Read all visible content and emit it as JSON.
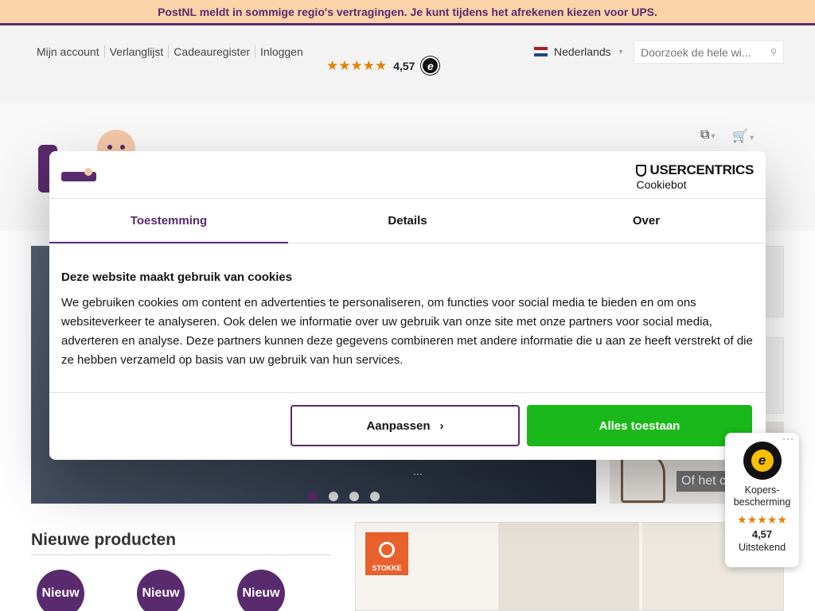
{
  "notice": {
    "text": "PostNL meldt in sommige regio's vertragingen. Je kunt tijdens het afrekenen kiezen voor UPS."
  },
  "toplinks": [
    "Mijn account",
    "Verlanglijst",
    "Cadeauregister",
    "Inloggen"
  ],
  "rating": {
    "stars": "★★★★★",
    "value": "4,57",
    "badge": "e"
  },
  "language": {
    "label": "Nederlands",
    "flag_colors": [
      "#ae1c28",
      "#ffffff",
      "#21468b"
    ]
  },
  "search": {
    "placeholder": "Doorzoek de hele wi..."
  },
  "hero": {
    "visible_text": "...",
    "dots": 4,
    "active_dot": 0
  },
  "side_banner": {
    "cta": "Of het c"
  },
  "new_products": {
    "title": "Nieuwe producten",
    "badge_label": "Nieuw"
  },
  "stokke": {
    "logo_text": "STOKKE"
  },
  "cookie": {
    "uc_brand": "USERCENTRICS",
    "uc_sub": "Cookiebot",
    "tabs": [
      "Toestemming",
      "Details",
      "Over"
    ],
    "heading": "Deze website maakt gebruik van cookies",
    "body": "We gebruiken cookies om content en advertenties te personaliseren, om functies voor social media te bieden en om ons websiteverkeer te analyseren. Ook delen we informatie over uw gebruik van onze site met onze partners voor social media, adverteren en analyse. Deze partners kunnen deze gegevens combineren met andere informatie die u aan ze heeft verstrekt of die ze hebben verzameld op basis van uw gebruik van hun services.",
    "btn_customize": "Aanpassen",
    "btn_allow": "Alles toestaan"
  },
  "trusted_shops": {
    "more": "···",
    "label_line1": "Kopers-",
    "label_line2": "bescherming",
    "stars": "★★★★★",
    "value": "4,57",
    "quality": "Uitstekend"
  },
  "colors": {
    "brand_purple": "#5a2a6e",
    "notice_bg": "#fbd3a8",
    "allow_green": "#1ab81a",
    "star_orange": "#e08400"
  }
}
